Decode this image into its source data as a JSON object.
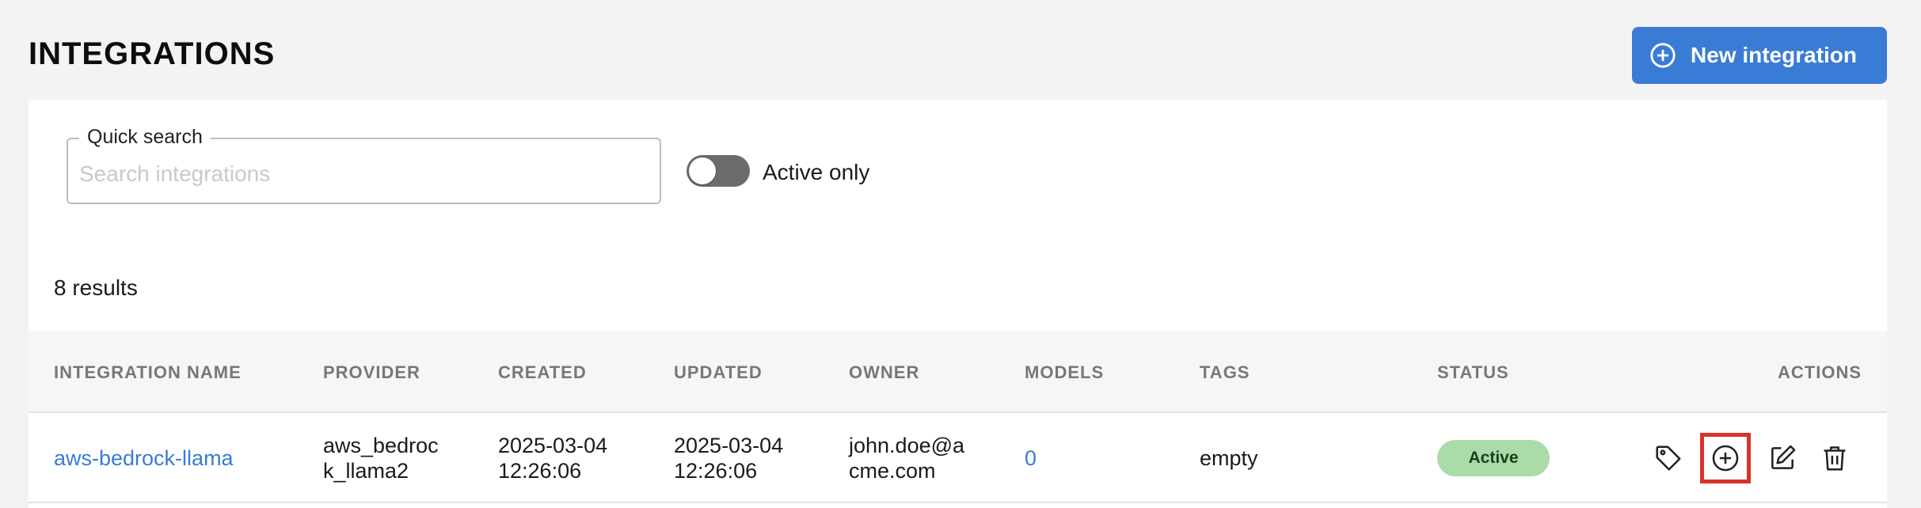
{
  "header": {
    "title": "INTEGRATIONS",
    "new_button_label": "New integration"
  },
  "filters": {
    "search_label": "Quick search",
    "search_placeholder": "Search integrations",
    "search_value": "",
    "active_only_label": "Active only",
    "active_only_on": false
  },
  "results_text": "8 results",
  "table": {
    "columns": [
      "INTEGRATION NAME",
      "PROVIDER",
      "CREATED",
      "UPDATED",
      "OWNER",
      "MODELS",
      "TAGS",
      "STATUS",
      "ACTIONS"
    ],
    "rows": [
      {
        "name": "aws-bedrock-llama",
        "provider_line1": "aws_bedroc",
        "provider_line2": "k_llama2",
        "created_date": "2025-03-04",
        "created_time": "12:26:06",
        "updated_date": "2025-03-04",
        "updated_time": "12:26:06",
        "owner_line1": "john.doe@a",
        "owner_line2": "cme.com",
        "models": "0",
        "tags": "empty",
        "status": "Active"
      }
    ]
  },
  "icons": {
    "new": "plus-circle-icon",
    "tag": "tag-icon",
    "add": "plus-circle-icon",
    "edit": "edit-icon",
    "delete": "trash-icon"
  },
  "colors": {
    "accent": "#3a7bd5",
    "status_active_bg": "#a9dca9",
    "highlight": "#d9322a"
  }
}
